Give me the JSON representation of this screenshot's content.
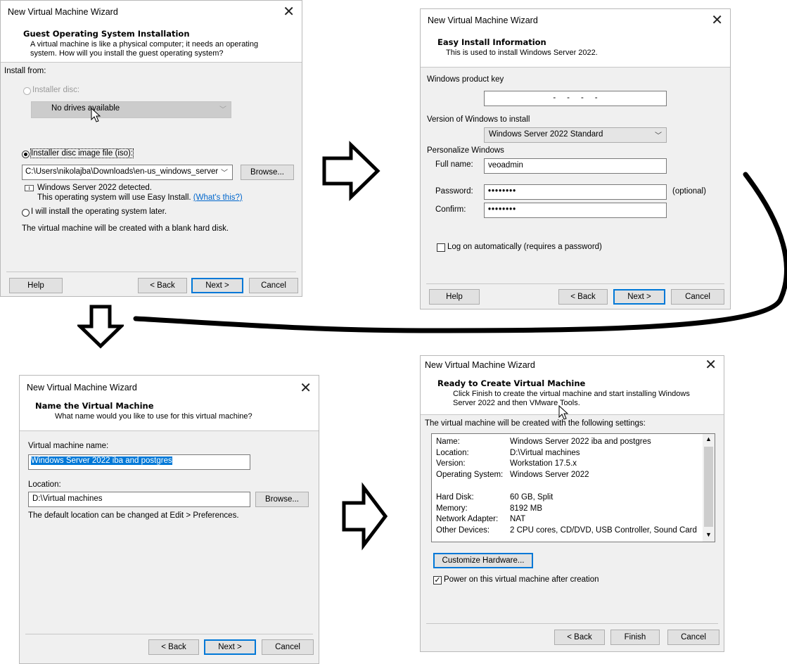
{
  "wizard_title": "New Virtual Machine Wizard",
  "w1": {
    "heading": "Guest Operating System Installation",
    "subheading_line1": "A virtual machine is like a physical computer; it needs an operating",
    "subheading_line2": "system. How will you install the guest operating system?",
    "install_from": "Install from:",
    "installer_disc": "Installer disc:",
    "no_drives": "No drives available",
    "iso_option": "Installer disc image file (iso):",
    "iso_path": "C:\\Users\\nikolajba\\Downloads\\en-us_windows_server",
    "browse": "Browse...",
    "detected": "Windows Server 2022 detected.",
    "easy_install": "This operating system will use Easy Install.",
    "whats_this": "(What's this?)",
    "later_option": "I will install the operating system later.",
    "blank_disk": "The virtual machine will be created with a blank hard disk.",
    "help": "Help",
    "back": "< Back",
    "next": "Next >",
    "cancel": "Cancel"
  },
  "w2": {
    "heading": "Easy Install Information",
    "subheading": "This is used to install Windows Server 2022.",
    "product_key_label": "Windows product key",
    "product_key_value": "-     -     -     -",
    "version_label": "Version of Windows to install",
    "version_value": "Windows Server 2022 Standard",
    "personalize": "Personalize Windows",
    "full_name_label": "Full name:",
    "full_name_value": "veoadmin",
    "password_label": "Password:",
    "password_value": "••••••••",
    "optional": "(optional)",
    "confirm_label": "Confirm:",
    "confirm_value": "••••••••",
    "logon_auto": "Log on automatically (requires a password)",
    "help": "Help",
    "back": "< Back",
    "next": "Next >",
    "cancel": "Cancel"
  },
  "w3": {
    "heading": "Name the Virtual Machine",
    "subheading": "What name would you like to use for this virtual machine?",
    "vm_name_label": "Virtual machine name:",
    "vm_name_value": "Windows Server 2022 iba and postgres",
    "location_label": "Location:",
    "location_value": "D:\\Virtual machines",
    "browse": "Browse...",
    "default_location_note": "The default location can be changed at Edit > Preferences.",
    "back": "< Back",
    "next": "Next >",
    "cancel": "Cancel"
  },
  "w4": {
    "heading": "Ready to Create Virtual Machine",
    "subheading_line1": "Click Finish to create the virtual machine and start installing Windows",
    "subheading_line2": "Server 2022 and then VMware Tools.",
    "settings_intro": "The virtual machine will be created with the following settings:",
    "settings": [
      {
        "key": "Name:",
        "value": "Windows Server 2022 iba and postgres"
      },
      {
        "key": "Location:",
        "value": "D:\\Virtual machines"
      },
      {
        "key": "Version:",
        "value": "Workstation 17.5.x"
      },
      {
        "key": "Operating System:",
        "value": "Windows Server 2022"
      },
      {
        "key": "Hard Disk:",
        "value": "60 GB, Split"
      },
      {
        "key": "Memory:",
        "value": "8192 MB"
      },
      {
        "key": "Network Adapter:",
        "value": "NAT"
      },
      {
        "key": "Other Devices:",
        "value": "2 CPU cores, CD/DVD, USB Controller, Sound Card"
      }
    ],
    "customize": "Customize Hardware...",
    "power_on": "Power on this virtual machine after creation",
    "back": "< Back",
    "finish": "Finish",
    "cancel": "Cancel"
  }
}
